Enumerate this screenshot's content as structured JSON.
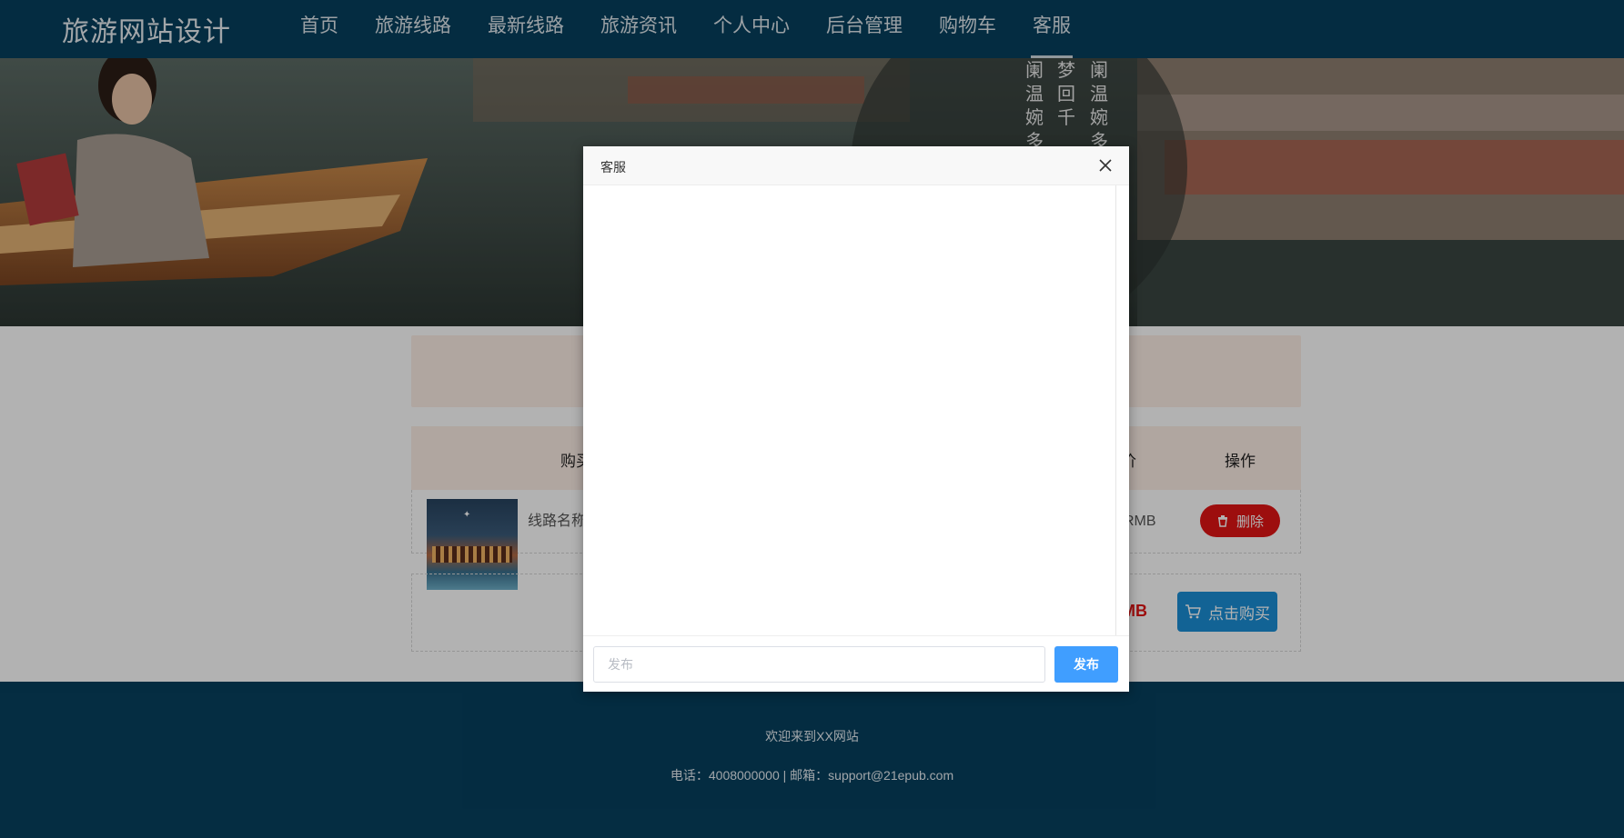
{
  "header": {
    "brand": "旅游网站设计",
    "nav": [
      "首页",
      "旅游线路",
      "最新线路",
      "旅游资讯",
      "个人中心",
      "后台管理",
      "购物车",
      "客服"
    ],
    "active_index": 7
  },
  "cart": {
    "head_left": "购买",
    "head_mid": "价",
    "head_op": "操作",
    "row": {
      "name_text": "线路名称",
      "price_tail": "RMB",
      "delete_label": "删除"
    },
    "summary": {
      "total_tail": "MB",
      "buy_label": "点击购买"
    }
  },
  "footer": {
    "welcome": "欢迎来到XX网站",
    "contact": "电话：4008000000 | 邮箱：support@21epub.com"
  },
  "dialog": {
    "title": "客服",
    "input_placeholder": "发布",
    "send_label": "发布"
  },
  "colors": {
    "header_bg": "#07405e",
    "cart_head_bg": "#fdeee6",
    "delete_red": "#e11515",
    "buy_blue": "#1b8fd6",
    "send_blue": "#409eff"
  },
  "icons": {
    "delete": "trash-icon",
    "buy": "cart-icon",
    "close": "close-icon"
  }
}
